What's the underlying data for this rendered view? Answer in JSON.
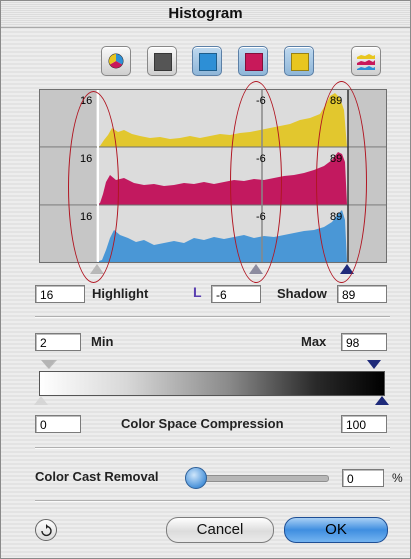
{
  "window": {
    "title": "Histogram"
  },
  "mode_buttons": [
    {
      "name": "color-wheel",
      "color": ""
    },
    {
      "name": "black-channel",
      "color": "#555555"
    },
    {
      "name": "cyan-channel",
      "color": "#2d8fd6"
    },
    {
      "name": "magenta-channel",
      "color": "#c8195a"
    },
    {
      "name": "yellow-channel",
      "color": "#e8c61f"
    }
  ],
  "channel_colors": {
    "yellow": "#e2c72e",
    "magenta": "#c2195f",
    "cyan": "#4a97d6"
  },
  "histogram": {
    "rows": [
      {
        "channel": "yellow",
        "highlight_label": "16",
        "midtone_label": "-6",
        "shadow_label": "89"
      },
      {
        "channel": "magenta",
        "highlight_label": "16",
        "midtone_label": "-6",
        "shadow_label": "89"
      },
      {
        "channel": "cyan",
        "highlight_label": "16",
        "midtone_label": "-6",
        "shadow_label": "89"
      }
    ]
  },
  "levels": {
    "highlight_value": "16",
    "highlight_label": "Highlight",
    "midtone_icon": "L",
    "midtone_value": "-6",
    "shadow_label": "Shadow",
    "shadow_value": "89"
  },
  "range": {
    "min_value": "2",
    "min_label": "Min",
    "max_label": "Max",
    "max_value": "98"
  },
  "compression": {
    "left_value": "0",
    "label": "Color Space Compression",
    "right_value": "100"
  },
  "cast_removal": {
    "label": "Color Cast Removal",
    "value": "0",
    "unit": "%",
    "slider_level": 0
  },
  "buttons": {
    "cancel": "Cancel",
    "ok": "OK"
  }
}
